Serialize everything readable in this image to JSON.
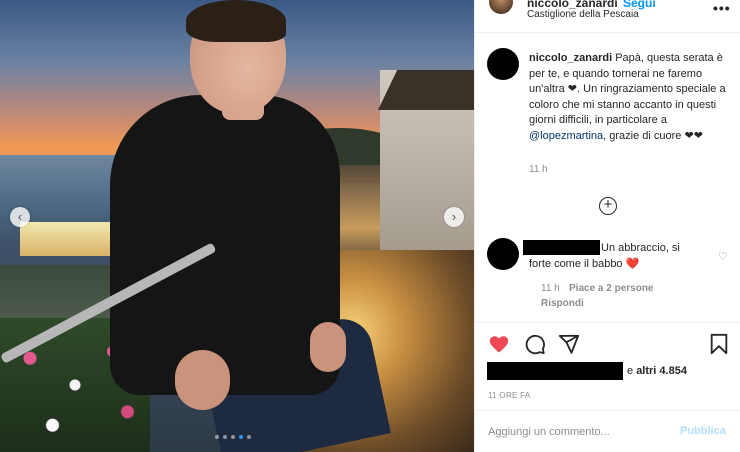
{
  "header": {
    "username": "niccolo_zanardi",
    "follow_label": "Segui",
    "location": "Castiglione della Pescaia",
    "more_glyph": "•••"
  },
  "caption": {
    "username": "niccolo_zanardi",
    "text_part1": "Papà, questa serata è per te, e quando tornerai ne faremo un'altra ❤. Un ringraziamento speciale a coloro che mi stanno accanto in questi giorni difficili, in particolare a",
    "mention": "@lopezmartina",
    "text_part2": ", grazie di cuore ❤❤",
    "time": "11 h"
  },
  "load_more_glyph": "+",
  "comment": {
    "text_line1": "Un abbraccio, si",
    "text_line2": "forte come il babbo ❤️",
    "like_glyph": "♡",
    "time": "11 h",
    "likes": "Piace a 2 persone",
    "reply_label": "Rispondi"
  },
  "likes": {
    "prefix": "e ",
    "count": "altri 4.854"
  },
  "post_time": "11 ORE FA",
  "add_comment": {
    "placeholder": "Aggiungi un commento...",
    "publish_label": "Pubblica"
  },
  "carousel": {
    "prev_glyph": "‹",
    "next_glyph": "›",
    "dots": 5,
    "active_dot": 4
  },
  "colors": {
    "like_red": "#ed4956",
    "link_blue": "#0095f6",
    "mention_blue": "#00376b",
    "publish_disabled": "#b2dffc",
    "muted_gray": "#8e8e8e"
  }
}
